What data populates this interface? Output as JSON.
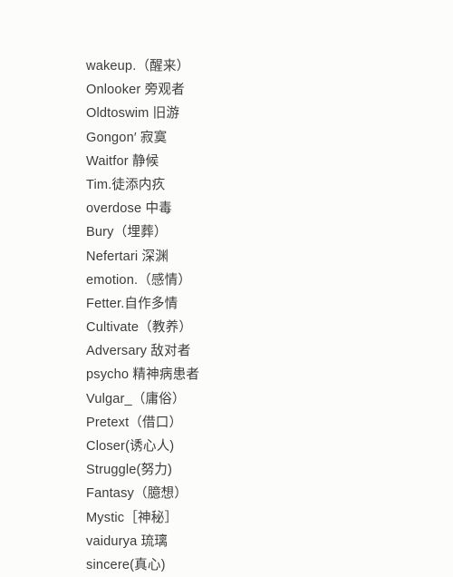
{
  "page": {
    "background_color": "#fcfdfa",
    "text_color": "#3c3c3c",
    "total_entries": 22
  },
  "word_list": {
    "entries": [
      {
        "text": "wakeup.（醒来）"
      },
      {
        "text": "Onlooker 旁观者"
      },
      {
        "text": "Oldtoswim 旧游"
      },
      {
        "text": "Gongon′ 寂寞"
      },
      {
        "text": "Waitfor 静候"
      },
      {
        "text": "Tim.徒添内疚"
      },
      {
        "text": "overdose 中毒"
      },
      {
        "text": "Bury（埋葬）"
      },
      {
        "text": "Nefertari 深渊"
      },
      {
        "text": "emotion.（感情）"
      },
      {
        "text": "Fetter.自作多情"
      },
      {
        "text": "Cultivate（教养）"
      },
      {
        "text": "Adversary 敌对者"
      },
      {
        "text": "psycho 精神病患者"
      },
      {
        "text": "Vulgar_（庸俗）"
      },
      {
        "text": "Pretext（借口）"
      },
      {
        "text": "Closer(诱心人)"
      },
      {
        "text": "Struggle(努力)"
      },
      {
        "text": "Fantasy（臆想）"
      },
      {
        "text": "Mystic［神秘］"
      },
      {
        "text": "vaidurya 琉璃"
      },
      {
        "text": "sincere(真心)"
      }
    ]
  }
}
